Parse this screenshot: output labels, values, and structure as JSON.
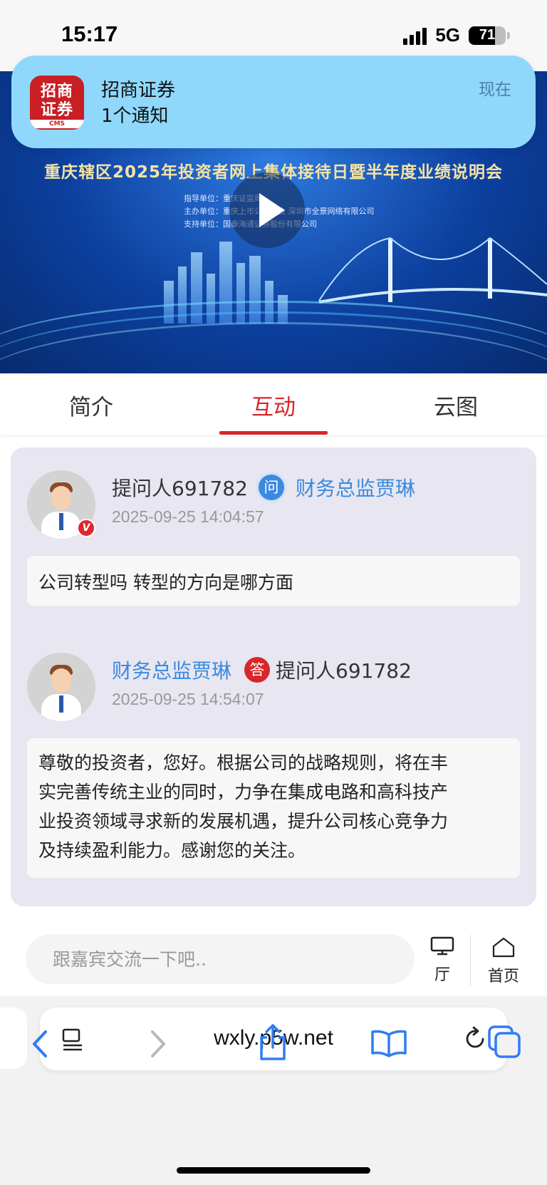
{
  "status_bar": {
    "time": "15:17",
    "network": "5G",
    "battery": "71"
  },
  "notification": {
    "app_icon_line1": "招商",
    "app_icon_line2": "证券",
    "app_icon_tag": "CMS",
    "app_name": "招商证券",
    "body": "1个通知",
    "time": "现在"
  },
  "hero": {
    "title": "重庆辖区2025年投资者网上集体接待日暨半年度业绩说明会",
    "meta": [
      "指导单位：重庆证监局",
      "主办单位：重庆上市公司协会 深圳市全景网络有限公司",
      "支持单位：国泰海通证券股份有限公司"
    ]
  },
  "tabs": [
    {
      "label": "简介",
      "active": false
    },
    {
      "label": "互动",
      "active": true
    },
    {
      "label": "云图",
      "active": false
    }
  ],
  "qa": {
    "question": {
      "asker": "提问人691782",
      "badge": "问",
      "target": "财务总监贾琳",
      "time": "2025-09-25 14:04:57",
      "content": "公司转型吗 转型的方向是哪方面",
      "verified_badge": "V"
    },
    "answer": {
      "responder": "财务总监贾琳",
      "badge": "答",
      "target": "提问人691782",
      "time": "2025-09-25 14:54:07",
      "lines": [
        "尊敬的投资者，您好。根据公司的战略规则，将在丰",
        "实完善传统主业的同时，力争在集成电路和高科技产",
        "业投资领域寻求新的发展机遇，提升公司核心竞争力",
        "及持续盈利能力。感谢您的关注。"
      ]
    }
  },
  "input_bar": {
    "placeholder": "跟嘉宾交流一下吧..",
    "hall_label": "厅",
    "home_label": "首页"
  },
  "browser": {
    "url": "wxly.p5w.net"
  },
  "colors": {
    "accent": "#d8262a",
    "link_blue": "#3a8ae0",
    "card_bg": "#e7e6f1"
  }
}
